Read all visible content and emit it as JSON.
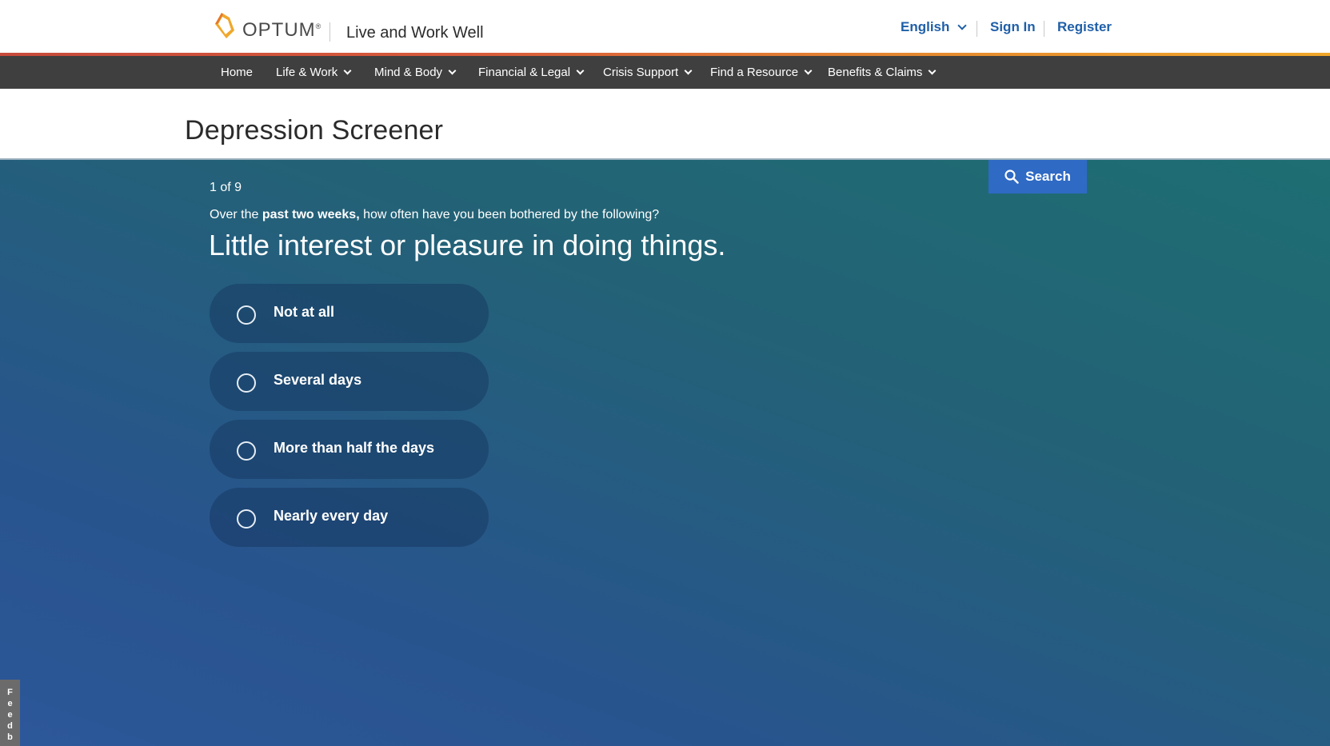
{
  "brand": {
    "logo_text": "OPTUM",
    "logo_reg": "®",
    "tagline": "Live and Work Well"
  },
  "utility": {
    "language": "English",
    "sign_in": "Sign In",
    "register": "Register"
  },
  "nav": {
    "items": [
      {
        "label": "Home"
      },
      {
        "label": "Life & Work"
      },
      {
        "label": "Mind & Body"
      },
      {
        "label": "Financial & Legal"
      },
      {
        "label": "Crisis Support"
      },
      {
        "label": "Find a Resource"
      },
      {
        "label": "Benefits & Claims"
      }
    ]
  },
  "page": {
    "title": "Depression Screener"
  },
  "search": {
    "label": "Search"
  },
  "screener": {
    "progress": "1 of 9",
    "prompt_pre": "Over the ",
    "prompt_bold": "past two weeks,",
    "prompt_post": " how often have you been bothered by the following?",
    "question": "Little interest or pleasure in doing things.",
    "options": [
      {
        "label": "Not at all"
      },
      {
        "label": "Several days"
      },
      {
        "label": "More than half the days"
      },
      {
        "label": "Nearly every day"
      }
    ]
  },
  "feedback": {
    "label": "Feedback"
  },
  "colors": {
    "accent_blue": "#1f5fa8",
    "search_button": "#2f6ac4",
    "nav_bg": "#3f3f3f",
    "logo_orange": "#f0a72a"
  }
}
